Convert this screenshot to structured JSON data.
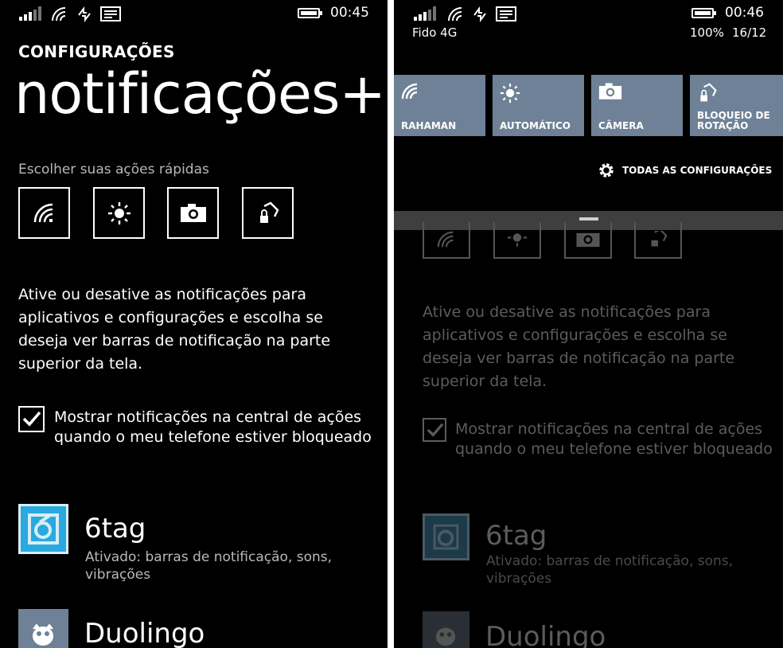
{
  "left": {
    "status": {
      "time": "00:45"
    },
    "app_title": "CONFIGURAÇÕES",
    "page_title": "notificações+ações",
    "quick_actions_label": "Escolher suas ações rápidas",
    "quick_actions": [
      {
        "icon": "wifi-icon"
      },
      {
        "icon": "brightness-icon"
      },
      {
        "icon": "camera-icon"
      },
      {
        "icon": "rotation-lock-icon"
      }
    ],
    "description": "Ative ou desative as notificações para aplicativos e configurações e escolha se deseja ver barras de notificação na parte superior da tela.",
    "checkbox_label": "Mostrar notificações na central de ações quando o meu telefone estiver bloqueado",
    "checkbox_checked": true,
    "apps": [
      {
        "name": "6tag",
        "status": "Ativado: barras de notificação, sons, vibrações",
        "icon": "6tag-icon",
        "color": "#29a9df"
      },
      {
        "name": "Duolingo",
        "icon": "duolingo-owl-icon",
        "color": "#6e8196"
      }
    ]
  },
  "right": {
    "status": {
      "time": "00:46",
      "carrier": "Fido 4G",
      "battery": "100%",
      "date": "16/12"
    },
    "tiles": [
      {
        "label": "RAHAMAN",
        "icon": "wifi-icon"
      },
      {
        "label": "AUTOMÁTICO",
        "icon": "brightness-icon"
      },
      {
        "label": "CÂMERA",
        "icon": "camera-icon"
      },
      {
        "label": "BLOQUEIO DE ROTAÇÃO",
        "icon": "rotation-lock-icon"
      }
    ],
    "all_settings_label": "TODAS AS CONFIGURAÇÕES",
    "description": "Ative ou desative as notificações para aplicativos e configurações e escolha se deseja ver barras de notificação na parte superior da tela.",
    "checkbox_label": "Mostrar notificações na central de ações quando o meu telefone estiver bloqueado",
    "apps": [
      {
        "name": "6tag",
        "status": "Ativado: barras de notificação, sons, vibrações"
      },
      {
        "name": "Duolingo"
      }
    ]
  },
  "colors": {
    "tile": "#6e8196",
    "accent_6tag": "#29a9df",
    "background": "#000000"
  }
}
